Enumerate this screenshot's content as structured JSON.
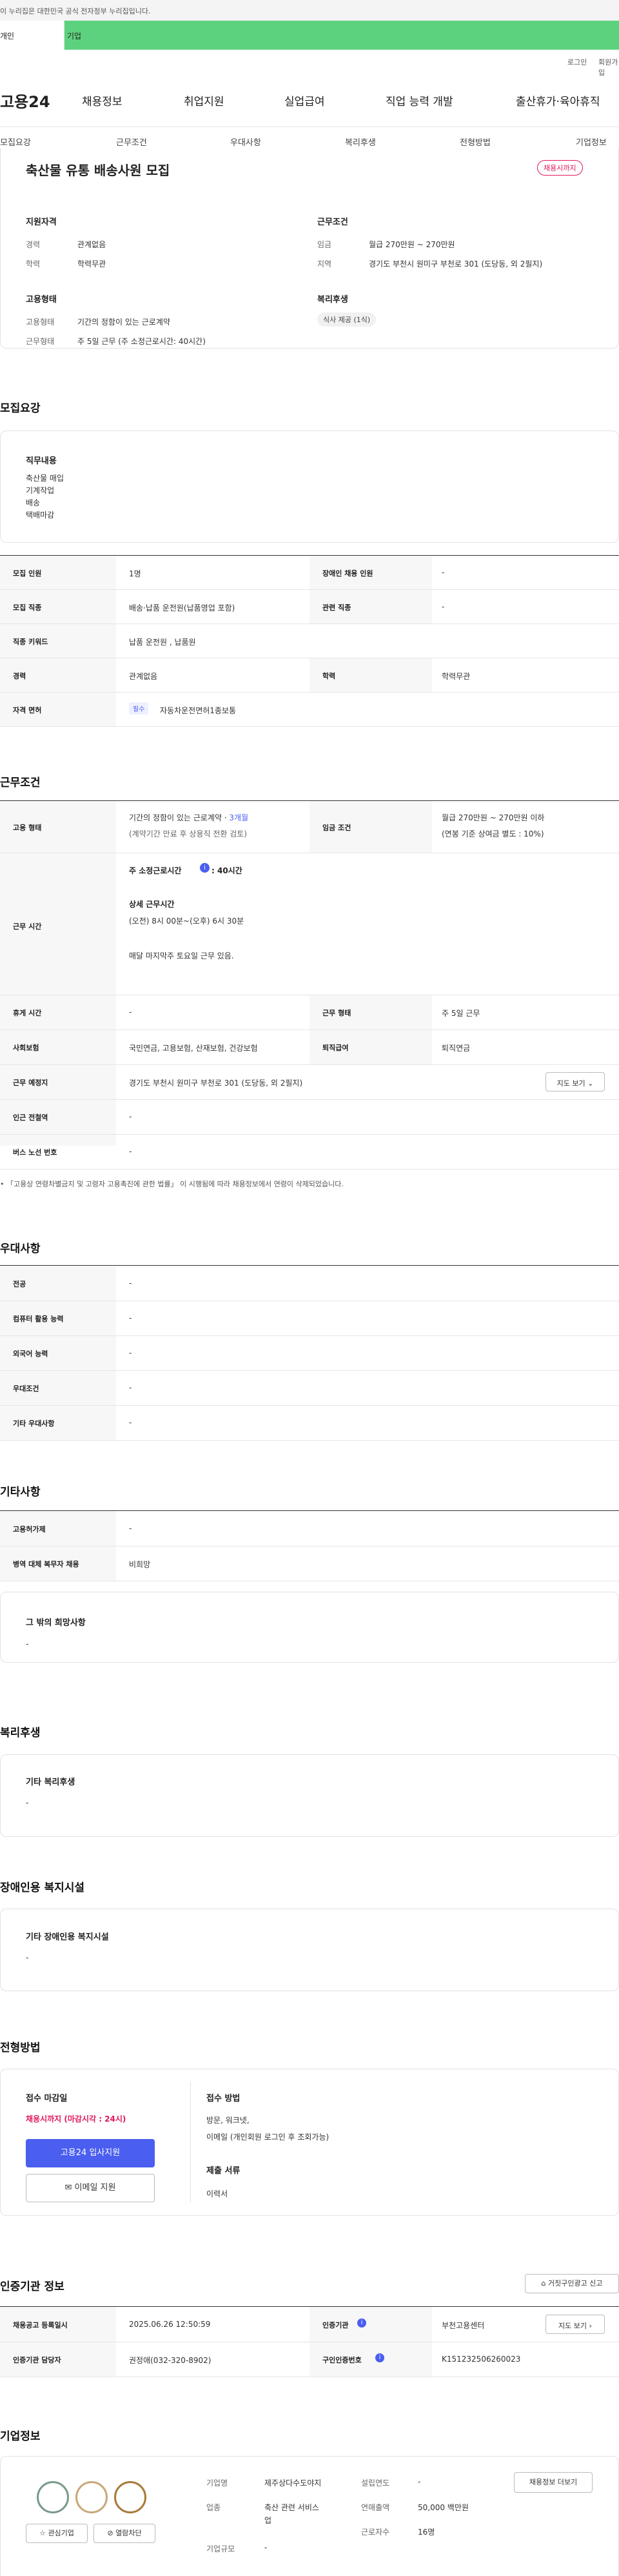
{
  "gov_banner": "이 누리집은 대한민국 공식 전자정부 누리집입니다.",
  "gbar": {
    "personal": "개인",
    "company": "기업"
  },
  "util": {
    "login": "로그인",
    "join": "회원가입"
  },
  "logo": "고용24",
  "gnb": [
    "채용정보",
    "취업지원",
    "실업급여",
    "직업 능력 개발",
    "출산휴가·육아휴직"
  ],
  "subnav": [
    "모집요강",
    "근무조건",
    "우대사항",
    "복리후생",
    "전형방법",
    "기업정보"
  ],
  "job": {
    "title": "축산물 유통 배송사원 모집",
    "badge": "채용시까지"
  },
  "summary": {
    "qual_title": "지원자격",
    "career_label": "경력",
    "career": "관계없음",
    "edu_label": "학력",
    "edu": "학력무관",
    "cond_title": "근무조건",
    "wage_label": "임금",
    "wage": "월급 270만원 ~ 270만원",
    "region_label": "지역",
    "region": "경기도 부천시 원미구 부천로 301 (도당동, 외 2필지)",
    "emp_title": "고용형태",
    "etype_label": "고용형태",
    "etype": "기간의 정함이 있는 근로계약",
    "wtype_label": "근무형태",
    "wtype": "주 5일 근무 (주 소정근로시간: 40시간)",
    "welfare_title": "복리후생",
    "welfare_tag": "식사 제공 (1식)"
  },
  "recruit": {
    "heading": "모집요강",
    "duty_title": "직무내용",
    "duties": [
      "축산물 매입",
      "기계작업",
      "배송",
      "택배마감"
    ],
    "rows": [
      {
        "k1": "모집 인원",
        "v1": "1명",
        "k2": "장애인 채용 인원",
        "v2": "-"
      },
      {
        "k1": "모집 직종",
        "v1": "배송·납품 운전원(납품영업 포함)",
        "k2": "관련 직종",
        "v2": "-"
      },
      {
        "k1": "직종 키워드",
        "v1": "납품 운전원 , 납품원"
      },
      {
        "k1": "경력",
        "v1": "관계없음",
        "k2": "학력",
        "v2": "학력무관"
      },
      {
        "k1": "자격 면허",
        "badge": "필수",
        "v1": "자동차운전면허1종보통"
      }
    ]
  },
  "work": {
    "heading": "근무조건",
    "etype_k": "고용 형태",
    "etype_v1": "기간의 정함이 있는 근로계약 · ",
    "etype_hl": "3개월",
    "etype_v2": "(계약기간 만료 후 상용직 전환 검토)",
    "wage_k": "임금 조건",
    "wage_v1": "월급 270만원 ~ 270만원 이하",
    "wage_v2": "(연봉 기준 상여금 별도 : 10%)",
    "time_k": "근무 시간",
    "time_a": "주 소정근로시간",
    "time_b": ": 40시간",
    "time_c": "상세 근무시간",
    "time_d": "(오전) 8시 00분~(오후) 6시 30분",
    "time_e": "매달 마지막주 토요일 근무 있음.",
    "rows": [
      {
        "k1": "휴게 시간",
        "v1": "-",
        "k2": "근무 형태",
        "v2": "주 5일 근무"
      },
      {
        "k1": "사회보험",
        "v1": "국민연금, 고용보험, 산재보험, 건강보험",
        "k2": "퇴직급여",
        "v2": "퇴직연금"
      },
      {
        "k1": "근무 예정지",
        "v1": "경기도 부천시 원미구 부천로 301 (도당동, 외 2필지)",
        "btn": "지도 보기"
      },
      {
        "k1": "인근 전철역",
        "v1": "-"
      },
      {
        "k1": "버스 노선 번호",
        "v1": "-"
      }
    ],
    "note": "「고용상 연령차별금지 및 고령자 고용촉진에 관한 법률」 이 시행됨에 따라 채용정보에서 연령이 삭제되었습니다."
  },
  "pref": {
    "heading": "우대사항",
    "rows": [
      {
        "k": "전공",
        "v": "-"
      },
      {
        "k": "컴퓨터 활용 능력",
        "v": "-"
      },
      {
        "k": "외국어 능력",
        "v": "-"
      },
      {
        "k": "우대조건",
        "v": "-"
      },
      {
        "k": "기타 우대사항",
        "v": "-"
      }
    ]
  },
  "etc": {
    "heading": "기타사항",
    "rows": [
      {
        "k": "고용허가제",
        "v": "-"
      },
      {
        "k": "병역 대체 복무자 채용",
        "v": "비희망"
      }
    ],
    "other_title": "그 밖의 희망사항",
    "other_v": "-"
  },
  "welfare": {
    "heading": "복리후생",
    "title": "기타 복리후생",
    "v": "-"
  },
  "disabled": {
    "heading": "장애인용 복지시설",
    "title": "기타 장애인용 복지시설",
    "v": "-"
  },
  "process": {
    "heading": "전형방법",
    "deadline_title": "접수 마감일",
    "deadline": "채용시까지 (마감시각 : 24시)",
    "apply_btn": "고용24 입사지원",
    "email_btn": "이메일 지원",
    "method_title": "접수 방법",
    "method": "방문, 워크넷,",
    "method2": "이메일 (개인회원 로그인 후 조회가능)",
    "doc_title": "제출 서류",
    "doc": "이력서"
  },
  "agency": {
    "heading": "인증기관 정보",
    "report_btn": "거짓구인광고 신고",
    "reg_k": "채용공고 등록일시",
    "reg_v": "2025.06.26 12:50:59",
    "agency_k": "인증기관",
    "agency_v": "부천고용센터",
    "agency_btn": "지도 보기",
    "mgr_k": "인증기관 담당자",
    "mgr_v": "권정애(032-320-8902)",
    "no_k": "구인인증번호",
    "no_v": "K151232506260023"
  },
  "company": {
    "heading": "기업정보",
    "name_k": "기업명",
    "name_v": "제주상다수도야지",
    "ind_k": "업종",
    "ind_v1": "축산 관련 서비스",
    "ind_v2": "업",
    "scale_k": "기업규모",
    "scale_v": "-",
    "year_k": "설립연도",
    "year_v": "-",
    "sales_k": "연매출액",
    "sales_v": "50,000 백만원",
    "emp_k": "근로자수",
    "emp_v": "16명",
    "jobs_btn": "채용정보 더보기",
    "fav_btn": "관심기업",
    "block_btn": "열람차단"
  },
  "colors": {
    "green": "#5dd27e",
    "blue": "#4a5ef0",
    "red": "#e2185b"
  }
}
